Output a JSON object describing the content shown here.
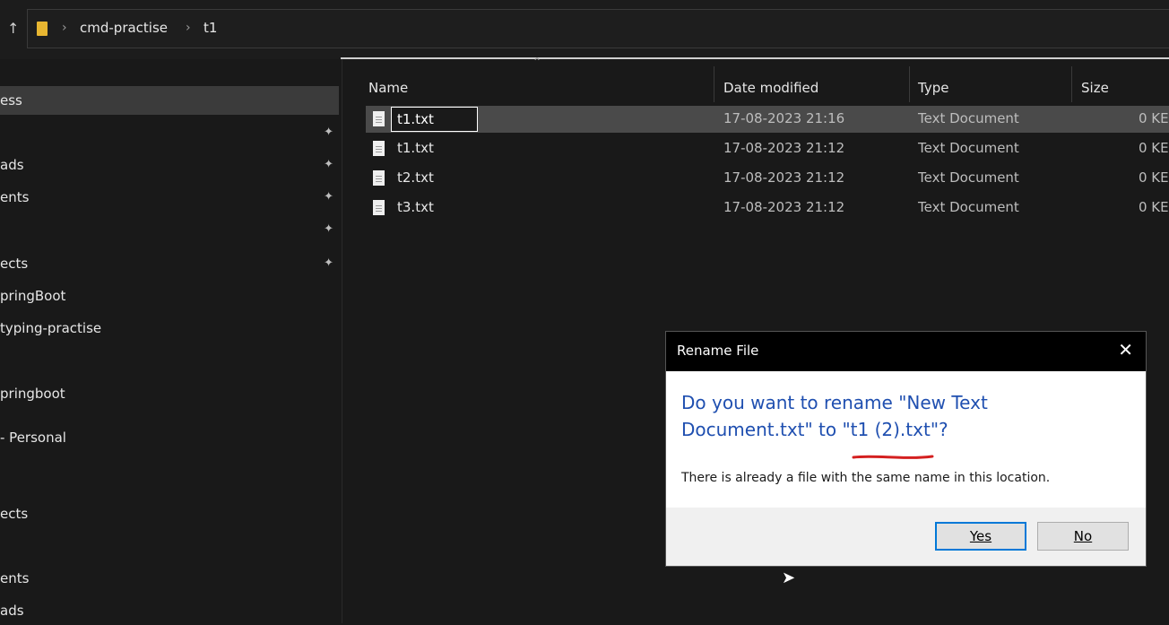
{
  "address_bar": {
    "crumbs": [
      "cmd-practise",
      "t1"
    ]
  },
  "sidebar": {
    "items": [
      {
        "label": "ess",
        "pinned": false,
        "selected": true
      },
      {
        "label": "",
        "pinned": true
      },
      {
        "label": "ads",
        "pinned": true
      },
      {
        "label": "ents",
        "pinned": true
      },
      {
        "label": "",
        "pinned": true
      },
      {
        "label": "ects",
        "pinned": true
      },
      {
        "label": "pringBoot",
        "pinned": false
      },
      {
        "label": "typing-practise",
        "pinned": false
      },
      {
        "label": "pringboot",
        "pinned": false
      },
      {
        "label": "- Personal",
        "pinned": false
      },
      {
        "label": "ects",
        "pinned": false
      },
      {
        "label": "",
        "pinned": false
      },
      {
        "label": "ents",
        "pinned": false
      },
      {
        "label": "ads",
        "pinned": false
      }
    ]
  },
  "table": {
    "columns": [
      "Name",
      "Date modified",
      "Type",
      "Size"
    ],
    "rows": [
      {
        "name": "t1.txt",
        "date": "17-08-2023 21:16",
        "type": "Text Document",
        "size": "0 KE",
        "editing": true
      },
      {
        "name": "t1.txt",
        "date": "17-08-2023 21:12",
        "type": "Text Document",
        "size": "0 KE"
      },
      {
        "name": "t2.txt",
        "date": "17-08-2023 21:12",
        "type": "Text Document",
        "size": "0 KE"
      },
      {
        "name": "t3.txt",
        "date": "17-08-2023 21:12",
        "type": "Text Document",
        "size": "0 KE"
      }
    ]
  },
  "dialog": {
    "title": "Rename File",
    "question_line1": "Do you want to rename \"New Text",
    "question_line2": "Document.txt\" to \"t1 (2).txt\"?",
    "info": "There is already a file with the same name in this location.",
    "yes_label": "Yes",
    "no_label": "No"
  },
  "colors": {
    "accent": "#0078d7",
    "question_text": "#1f4fb0",
    "folder": "#e8b631",
    "annotation": "#d42020"
  },
  "icons": [
    "up-arrow-icon",
    "folder-icon",
    "chevron-right-icon",
    "pin-icon",
    "text-file-icon",
    "close-icon",
    "mouse-cursor-icon"
  ]
}
